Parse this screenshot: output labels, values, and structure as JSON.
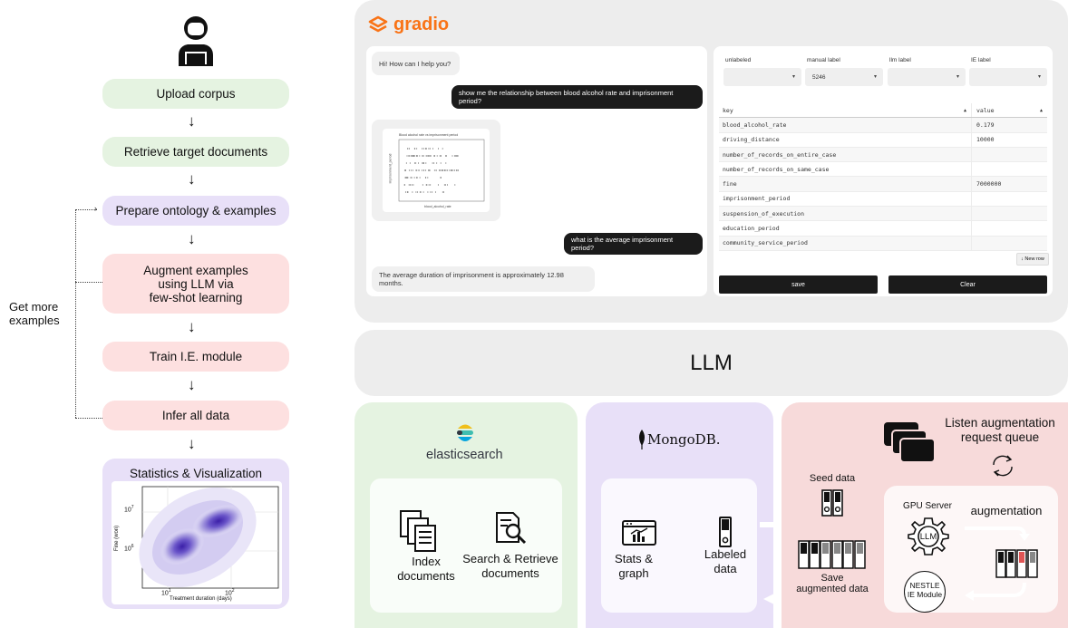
{
  "workflow": {
    "steps": [
      "Upload corpus",
      "Retrieve target documents",
      "Prepare ontology & examples",
      "Augment examples\nusing LLM via\nfew-shot learning",
      "Train I.E. module",
      "Infer all data",
      "Statistics & Visualization"
    ],
    "arrow_glyph": "↓",
    "loop_label": "Get more\nexamples",
    "kde_plot": {
      "ylabel": "Fine (won)",
      "xlabel": "Treatment duration (days)",
      "ytick_top": "10",
      "ytick_top_exp": "7",
      "ytick_bottom": "10",
      "ytick_bottom_exp": "6",
      "xtick_left": "10",
      "xtick_left_exp": "1",
      "xtick_right": "10",
      "xtick_right_exp": "2"
    }
  },
  "gradio": {
    "brand": "gradio",
    "chat": {
      "messages": [
        {
          "role": "bot",
          "text": "Hi! How can I help you?"
        },
        {
          "role": "user",
          "text": "show me the relationship between blood alcohol rate and imprisonment period?"
        },
        {
          "role": "user",
          "text": "what is the average imprisonment period?"
        },
        {
          "role": "bot",
          "text": "The average duration of imprisonment is approximately 12.98 months."
        }
      ],
      "scatter": {
        "title": "Blood alcohol rate vs imprisonment period",
        "xlabel": "blood_alcohol_rate",
        "ylabel": "imprisonment_period"
      }
    },
    "form": {
      "dropdowns": [
        {
          "label": "unlabeled",
          "value": ""
        },
        {
          "label": "manual label",
          "value": "5246"
        },
        {
          "label": "llm label",
          "value": ""
        },
        {
          "label": "IE label",
          "value": ""
        }
      ],
      "table": {
        "headers": [
          "key",
          "value"
        ],
        "rows": [
          {
            "key": "blood_alcohol_rate",
            "value": "0.179"
          },
          {
            "key": "driving_distance",
            "value": "10000"
          },
          {
            "key": "number_of_records_on_entire_case",
            "value": ""
          },
          {
            "key": "number_of_records_on_same_case",
            "value": ""
          },
          {
            "key": "fine",
            "value": "7000000"
          },
          {
            "key": "imprisonment_period",
            "value": ""
          },
          {
            "key": "suspension_of_execution",
            "value": ""
          },
          {
            "key": "education_period",
            "value": ""
          },
          {
            "key": "community_service_period",
            "value": ""
          }
        ]
      },
      "new_row_label": "↓ New row",
      "save_label": "save",
      "clear_label": "Clear"
    }
  },
  "llm_bar": {
    "label": "LLM"
  },
  "elasticsearch": {
    "brand": "elasticsearch",
    "index_label": "Index\ndocuments",
    "search_label": "Search & Retrieve\ndocuments"
  },
  "mongodb": {
    "brand": "MongoDB.",
    "stats_label": "Stats &\ngraph",
    "labeled_label": "Labeled\ndata"
  },
  "llm_service": {
    "queue_label": "Listen augmentation\nrequest queue",
    "seed_label": "Seed data",
    "save_label": "Save\naugmented data",
    "gpu_label": "GPU Server",
    "llm_chip": "LLM",
    "augmentation_label": "augmentation",
    "ie_module_label": "NESTLE\nIE Module"
  }
}
